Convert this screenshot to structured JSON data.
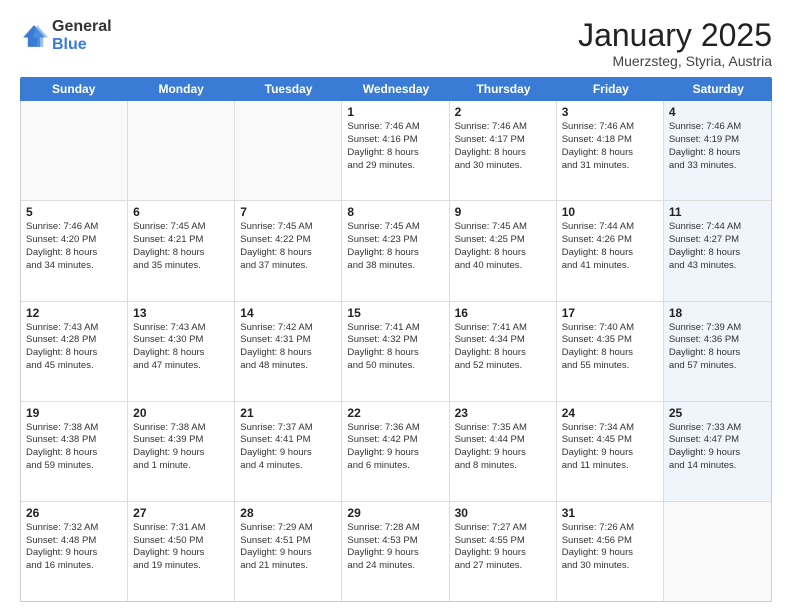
{
  "logo": {
    "general": "General",
    "blue": "Blue"
  },
  "title": "January 2025",
  "subtitle": "Muerzsteg, Styria, Austria",
  "headers": [
    "Sunday",
    "Monday",
    "Tuesday",
    "Wednesday",
    "Thursday",
    "Friday",
    "Saturday"
  ],
  "weeks": [
    [
      {
        "day": "",
        "text": ""
      },
      {
        "day": "",
        "text": ""
      },
      {
        "day": "",
        "text": ""
      },
      {
        "day": "1",
        "text": "Sunrise: 7:46 AM\nSunset: 4:16 PM\nDaylight: 8 hours\nand 29 minutes."
      },
      {
        "day": "2",
        "text": "Sunrise: 7:46 AM\nSunset: 4:17 PM\nDaylight: 8 hours\nand 30 minutes."
      },
      {
        "day": "3",
        "text": "Sunrise: 7:46 AM\nSunset: 4:18 PM\nDaylight: 8 hours\nand 31 minutes."
      },
      {
        "day": "4",
        "text": "Sunrise: 7:46 AM\nSunset: 4:19 PM\nDaylight: 8 hours\nand 33 minutes."
      }
    ],
    [
      {
        "day": "5",
        "text": "Sunrise: 7:46 AM\nSunset: 4:20 PM\nDaylight: 8 hours\nand 34 minutes."
      },
      {
        "day": "6",
        "text": "Sunrise: 7:45 AM\nSunset: 4:21 PM\nDaylight: 8 hours\nand 35 minutes."
      },
      {
        "day": "7",
        "text": "Sunrise: 7:45 AM\nSunset: 4:22 PM\nDaylight: 8 hours\nand 37 minutes."
      },
      {
        "day": "8",
        "text": "Sunrise: 7:45 AM\nSunset: 4:23 PM\nDaylight: 8 hours\nand 38 minutes."
      },
      {
        "day": "9",
        "text": "Sunrise: 7:45 AM\nSunset: 4:25 PM\nDaylight: 8 hours\nand 40 minutes."
      },
      {
        "day": "10",
        "text": "Sunrise: 7:44 AM\nSunset: 4:26 PM\nDaylight: 8 hours\nand 41 minutes."
      },
      {
        "day": "11",
        "text": "Sunrise: 7:44 AM\nSunset: 4:27 PM\nDaylight: 8 hours\nand 43 minutes."
      }
    ],
    [
      {
        "day": "12",
        "text": "Sunrise: 7:43 AM\nSunset: 4:28 PM\nDaylight: 8 hours\nand 45 minutes."
      },
      {
        "day": "13",
        "text": "Sunrise: 7:43 AM\nSunset: 4:30 PM\nDaylight: 8 hours\nand 47 minutes."
      },
      {
        "day": "14",
        "text": "Sunrise: 7:42 AM\nSunset: 4:31 PM\nDaylight: 8 hours\nand 48 minutes."
      },
      {
        "day": "15",
        "text": "Sunrise: 7:41 AM\nSunset: 4:32 PM\nDaylight: 8 hours\nand 50 minutes."
      },
      {
        "day": "16",
        "text": "Sunrise: 7:41 AM\nSunset: 4:34 PM\nDaylight: 8 hours\nand 52 minutes."
      },
      {
        "day": "17",
        "text": "Sunrise: 7:40 AM\nSunset: 4:35 PM\nDaylight: 8 hours\nand 55 minutes."
      },
      {
        "day": "18",
        "text": "Sunrise: 7:39 AM\nSunset: 4:36 PM\nDaylight: 8 hours\nand 57 minutes."
      }
    ],
    [
      {
        "day": "19",
        "text": "Sunrise: 7:38 AM\nSunset: 4:38 PM\nDaylight: 8 hours\nand 59 minutes."
      },
      {
        "day": "20",
        "text": "Sunrise: 7:38 AM\nSunset: 4:39 PM\nDaylight: 9 hours\nand 1 minute."
      },
      {
        "day": "21",
        "text": "Sunrise: 7:37 AM\nSunset: 4:41 PM\nDaylight: 9 hours\nand 4 minutes."
      },
      {
        "day": "22",
        "text": "Sunrise: 7:36 AM\nSunset: 4:42 PM\nDaylight: 9 hours\nand 6 minutes."
      },
      {
        "day": "23",
        "text": "Sunrise: 7:35 AM\nSunset: 4:44 PM\nDaylight: 9 hours\nand 8 minutes."
      },
      {
        "day": "24",
        "text": "Sunrise: 7:34 AM\nSunset: 4:45 PM\nDaylight: 9 hours\nand 11 minutes."
      },
      {
        "day": "25",
        "text": "Sunrise: 7:33 AM\nSunset: 4:47 PM\nDaylight: 9 hours\nand 14 minutes."
      }
    ],
    [
      {
        "day": "26",
        "text": "Sunrise: 7:32 AM\nSunset: 4:48 PM\nDaylight: 9 hours\nand 16 minutes."
      },
      {
        "day": "27",
        "text": "Sunrise: 7:31 AM\nSunset: 4:50 PM\nDaylight: 9 hours\nand 19 minutes."
      },
      {
        "day": "28",
        "text": "Sunrise: 7:29 AM\nSunset: 4:51 PM\nDaylight: 9 hours\nand 21 minutes."
      },
      {
        "day": "29",
        "text": "Sunrise: 7:28 AM\nSunset: 4:53 PM\nDaylight: 9 hours\nand 24 minutes."
      },
      {
        "day": "30",
        "text": "Sunrise: 7:27 AM\nSunset: 4:55 PM\nDaylight: 9 hours\nand 27 minutes."
      },
      {
        "day": "31",
        "text": "Sunrise: 7:26 AM\nSunset: 4:56 PM\nDaylight: 9 hours\nand 30 minutes."
      },
      {
        "day": "",
        "text": ""
      }
    ]
  ]
}
